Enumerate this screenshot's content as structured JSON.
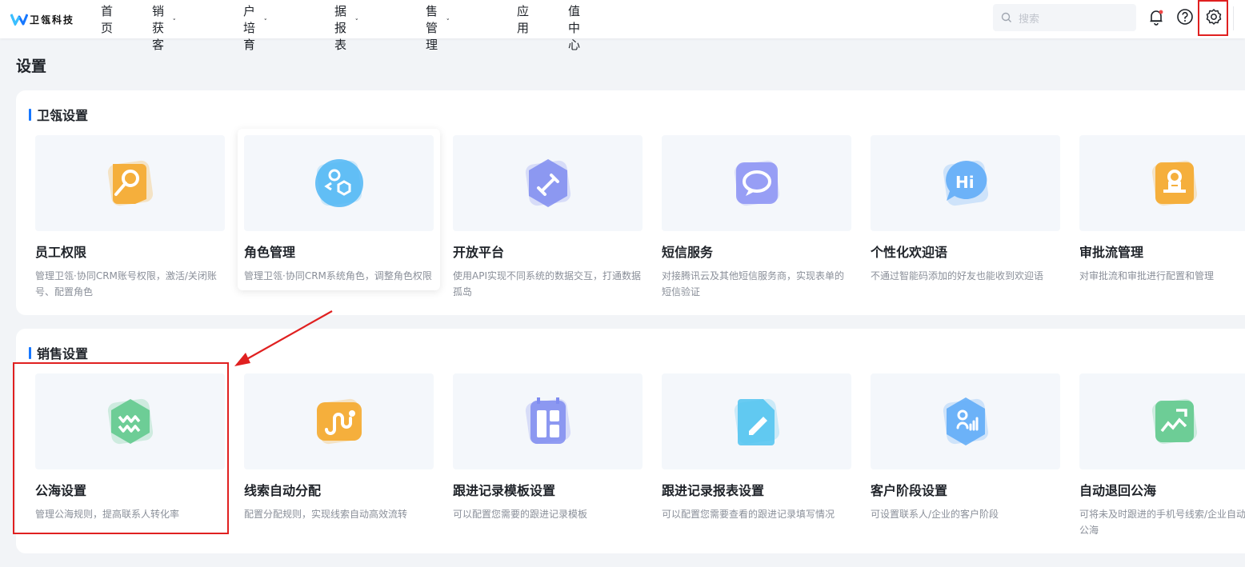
{
  "app": {
    "logo_text": "卫瓴科技"
  },
  "nav": {
    "items": [
      {
        "label": "首页",
        "has_dropdown": false
      },
      {
        "label": "营销获客",
        "has_dropdown": true
      },
      {
        "label": "客户培育",
        "has_dropdown": true
      },
      {
        "label": "数据报表",
        "has_dropdown": true
      },
      {
        "label": "销售管理",
        "has_dropdown": true
      },
      {
        "label": "应用",
        "has_dropdown": false
      },
      {
        "label": "增值中心",
        "has_dropdown": false
      }
    ],
    "search_placeholder": "搜索",
    "icons": [
      "bell-icon",
      "help-icon",
      "gear-icon"
    ]
  },
  "page": {
    "title": "设置"
  },
  "sections": [
    {
      "title": "卫瓴设置",
      "tiles": [
        {
          "name": "员工权限",
          "desc": "管理卫瓴·协同CRM账号权限，激活/关闭账号、配置角色",
          "icon": "key-icon",
          "color": "#f5a623"
        },
        {
          "name": "角色管理",
          "desc": "管理卫瓴·协同CRM系统角色，调整角色权限",
          "icon": "role-icon",
          "color": "#4fb6f5"
        },
        {
          "name": "开放平台",
          "desc": "使用API实现不同系统的数据交互，打通数据孤岛",
          "icon": "plug-icon",
          "color": "#7f8cf0"
        },
        {
          "name": "短信服务",
          "desc": "对接腾讯云及其他短信服务商，实现表单的短信验证",
          "icon": "message-icon",
          "color": "#8b93f5"
        },
        {
          "name": "个性化欢迎语",
          "desc": "不通过智能码添加的好友也能收到欢迎语",
          "icon": "hi-icon",
          "color": "#5aa9f7"
        },
        {
          "name": "审批流管理",
          "desc": "对审批流和审批进行配置和管理",
          "icon": "stamp-icon",
          "color": "#f5a623"
        }
      ]
    },
    {
      "title": "销售设置",
      "tiles": [
        {
          "name": "公海设置",
          "desc": "管理公海规则，提高联系人转化率",
          "icon": "sea-icon",
          "color": "#5cc88a"
        },
        {
          "name": "线索自动分配",
          "desc": "配置分配规则，实现线索自动高效流转",
          "icon": "route-icon",
          "color": "#f5a623"
        },
        {
          "name": "跟进记录模板设置",
          "desc": "可以配置您需要的跟进记录模板",
          "icon": "template-icon",
          "color": "#7f8cf0"
        },
        {
          "name": "跟进记录报表设置",
          "desc": "可以配置您需要查看的跟进记录填写情况",
          "icon": "report-icon",
          "color": "#4fc3f0"
        },
        {
          "name": "客户阶段设置",
          "desc": "可设置联系人/企业的客户阶段",
          "icon": "stage-icon",
          "color": "#5aa9f7"
        },
        {
          "name": "自动退回公海",
          "desc": "可将未及时跟进的手机号线索/企业自动退回公海",
          "icon": "return-icon",
          "color": "#5cc88a"
        }
      ]
    }
  ],
  "colors": {
    "accent": "#1677ff",
    "highlight": "#e02020"
  }
}
